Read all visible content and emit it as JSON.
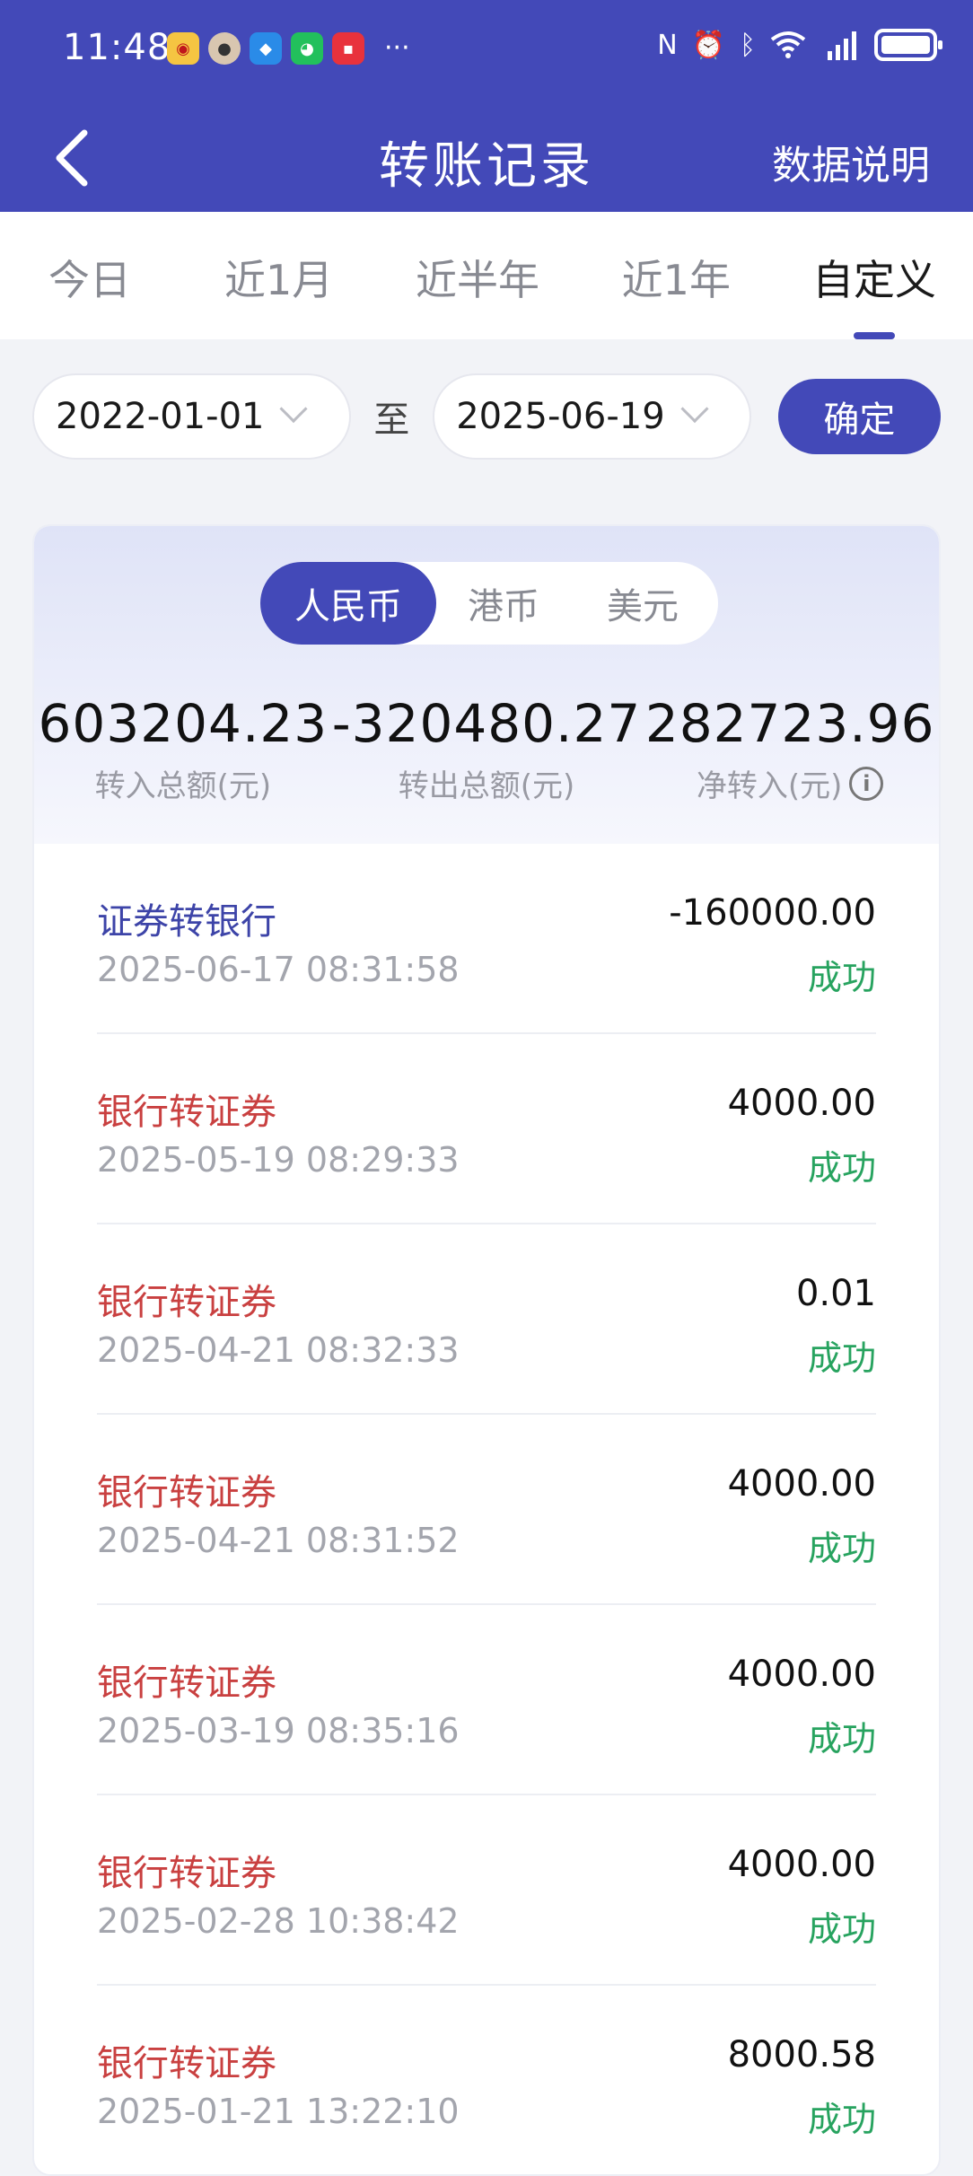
{
  "status_bar": {
    "time": "11:48",
    "more": "···",
    "right_icons": [
      "nfc-icon",
      "alarm-icon",
      "bluetooth-icon",
      "wifi-icon",
      "4g-signal-icon",
      "battery-icon"
    ]
  },
  "header": {
    "title": "转账记录",
    "action": "数据说明"
  },
  "tabs": [
    {
      "label": "今日"
    },
    {
      "label": "近1月"
    },
    {
      "label": "近半年"
    },
    {
      "label": "近1年"
    },
    {
      "label": "自定义"
    }
  ],
  "date_filter": {
    "start": "2022-01-01",
    "separator": "至",
    "end": "2025-06-19",
    "confirm": "确定"
  },
  "currencies": [
    "人民币",
    "港币",
    "美元"
  ],
  "summary": {
    "in_total": "603204.23",
    "in_label": "转入总额(元)",
    "out_total": "-320480.27",
    "out_label": "转出总额(元)",
    "net_total": "282723.96",
    "net_label": "净转入(元)"
  },
  "records": [
    {
      "type": "证券转银行",
      "time": "2025-06-17 08:31:58",
      "amount": "-160000.00",
      "status": "成功"
    },
    {
      "type": "银行转证券",
      "time": "2025-05-19 08:29:33",
      "amount": "4000.00",
      "status": "成功"
    },
    {
      "type": "银行转证券",
      "time": "2025-04-21 08:32:33",
      "amount": "0.01",
      "status": "成功"
    },
    {
      "type": "银行转证券",
      "time": "2025-04-21 08:31:52",
      "amount": "4000.00",
      "status": "成功"
    },
    {
      "type": "银行转证券",
      "time": "2025-03-19 08:35:16",
      "amount": "4000.00",
      "status": "成功"
    },
    {
      "type": "银行转证券",
      "time": "2025-02-28 10:38:42",
      "amount": "4000.00",
      "status": "成功"
    },
    {
      "type": "银行转证券",
      "time": "2025-01-21 13:22:10",
      "amount": "8000.58",
      "status": "成功"
    }
  ],
  "colors": {
    "brand": "#4349b8",
    "success": "#27a35f",
    "incoming": "#c94040",
    "outgoing": "#3d44a8"
  }
}
